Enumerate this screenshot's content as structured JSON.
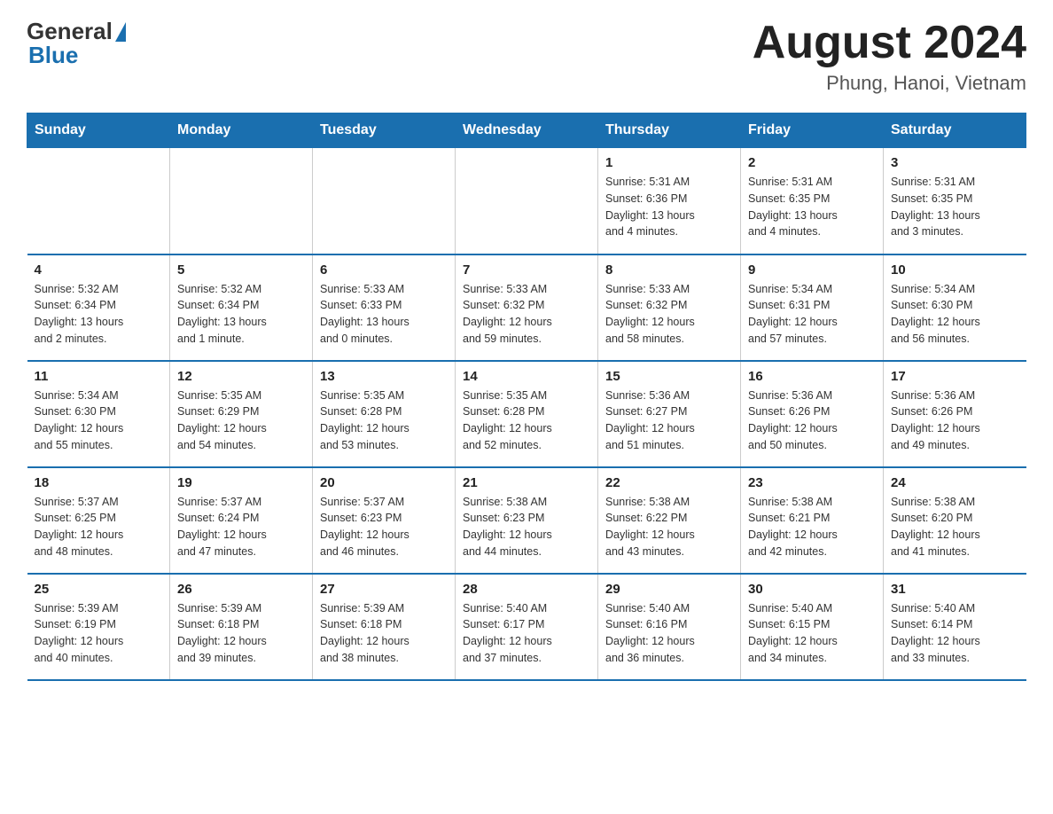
{
  "header": {
    "logo_general": "General",
    "logo_blue": "Blue",
    "month_title": "August 2024",
    "location": "Phung, Hanoi, Vietnam"
  },
  "days_of_week": [
    "Sunday",
    "Monday",
    "Tuesday",
    "Wednesday",
    "Thursday",
    "Friday",
    "Saturday"
  ],
  "weeks": [
    [
      {
        "day": "",
        "info": ""
      },
      {
        "day": "",
        "info": ""
      },
      {
        "day": "",
        "info": ""
      },
      {
        "day": "",
        "info": ""
      },
      {
        "day": "1",
        "info": "Sunrise: 5:31 AM\nSunset: 6:36 PM\nDaylight: 13 hours\nand 4 minutes."
      },
      {
        "day": "2",
        "info": "Sunrise: 5:31 AM\nSunset: 6:35 PM\nDaylight: 13 hours\nand 4 minutes."
      },
      {
        "day": "3",
        "info": "Sunrise: 5:31 AM\nSunset: 6:35 PM\nDaylight: 13 hours\nand 3 minutes."
      }
    ],
    [
      {
        "day": "4",
        "info": "Sunrise: 5:32 AM\nSunset: 6:34 PM\nDaylight: 13 hours\nand 2 minutes."
      },
      {
        "day": "5",
        "info": "Sunrise: 5:32 AM\nSunset: 6:34 PM\nDaylight: 13 hours\nand 1 minute."
      },
      {
        "day": "6",
        "info": "Sunrise: 5:33 AM\nSunset: 6:33 PM\nDaylight: 13 hours\nand 0 minutes."
      },
      {
        "day": "7",
        "info": "Sunrise: 5:33 AM\nSunset: 6:32 PM\nDaylight: 12 hours\nand 59 minutes."
      },
      {
        "day": "8",
        "info": "Sunrise: 5:33 AM\nSunset: 6:32 PM\nDaylight: 12 hours\nand 58 minutes."
      },
      {
        "day": "9",
        "info": "Sunrise: 5:34 AM\nSunset: 6:31 PM\nDaylight: 12 hours\nand 57 minutes."
      },
      {
        "day": "10",
        "info": "Sunrise: 5:34 AM\nSunset: 6:30 PM\nDaylight: 12 hours\nand 56 minutes."
      }
    ],
    [
      {
        "day": "11",
        "info": "Sunrise: 5:34 AM\nSunset: 6:30 PM\nDaylight: 12 hours\nand 55 minutes."
      },
      {
        "day": "12",
        "info": "Sunrise: 5:35 AM\nSunset: 6:29 PM\nDaylight: 12 hours\nand 54 minutes."
      },
      {
        "day": "13",
        "info": "Sunrise: 5:35 AM\nSunset: 6:28 PM\nDaylight: 12 hours\nand 53 minutes."
      },
      {
        "day": "14",
        "info": "Sunrise: 5:35 AM\nSunset: 6:28 PM\nDaylight: 12 hours\nand 52 minutes."
      },
      {
        "day": "15",
        "info": "Sunrise: 5:36 AM\nSunset: 6:27 PM\nDaylight: 12 hours\nand 51 minutes."
      },
      {
        "day": "16",
        "info": "Sunrise: 5:36 AM\nSunset: 6:26 PM\nDaylight: 12 hours\nand 50 minutes."
      },
      {
        "day": "17",
        "info": "Sunrise: 5:36 AM\nSunset: 6:26 PM\nDaylight: 12 hours\nand 49 minutes."
      }
    ],
    [
      {
        "day": "18",
        "info": "Sunrise: 5:37 AM\nSunset: 6:25 PM\nDaylight: 12 hours\nand 48 minutes."
      },
      {
        "day": "19",
        "info": "Sunrise: 5:37 AM\nSunset: 6:24 PM\nDaylight: 12 hours\nand 47 minutes."
      },
      {
        "day": "20",
        "info": "Sunrise: 5:37 AM\nSunset: 6:23 PM\nDaylight: 12 hours\nand 46 minutes."
      },
      {
        "day": "21",
        "info": "Sunrise: 5:38 AM\nSunset: 6:23 PM\nDaylight: 12 hours\nand 44 minutes."
      },
      {
        "day": "22",
        "info": "Sunrise: 5:38 AM\nSunset: 6:22 PM\nDaylight: 12 hours\nand 43 minutes."
      },
      {
        "day": "23",
        "info": "Sunrise: 5:38 AM\nSunset: 6:21 PM\nDaylight: 12 hours\nand 42 minutes."
      },
      {
        "day": "24",
        "info": "Sunrise: 5:38 AM\nSunset: 6:20 PM\nDaylight: 12 hours\nand 41 minutes."
      }
    ],
    [
      {
        "day": "25",
        "info": "Sunrise: 5:39 AM\nSunset: 6:19 PM\nDaylight: 12 hours\nand 40 minutes."
      },
      {
        "day": "26",
        "info": "Sunrise: 5:39 AM\nSunset: 6:18 PM\nDaylight: 12 hours\nand 39 minutes."
      },
      {
        "day": "27",
        "info": "Sunrise: 5:39 AM\nSunset: 6:18 PM\nDaylight: 12 hours\nand 38 minutes."
      },
      {
        "day": "28",
        "info": "Sunrise: 5:40 AM\nSunset: 6:17 PM\nDaylight: 12 hours\nand 37 minutes."
      },
      {
        "day": "29",
        "info": "Sunrise: 5:40 AM\nSunset: 6:16 PM\nDaylight: 12 hours\nand 36 minutes."
      },
      {
        "day": "30",
        "info": "Sunrise: 5:40 AM\nSunset: 6:15 PM\nDaylight: 12 hours\nand 34 minutes."
      },
      {
        "day": "31",
        "info": "Sunrise: 5:40 AM\nSunset: 6:14 PM\nDaylight: 12 hours\nand 33 minutes."
      }
    ]
  ]
}
